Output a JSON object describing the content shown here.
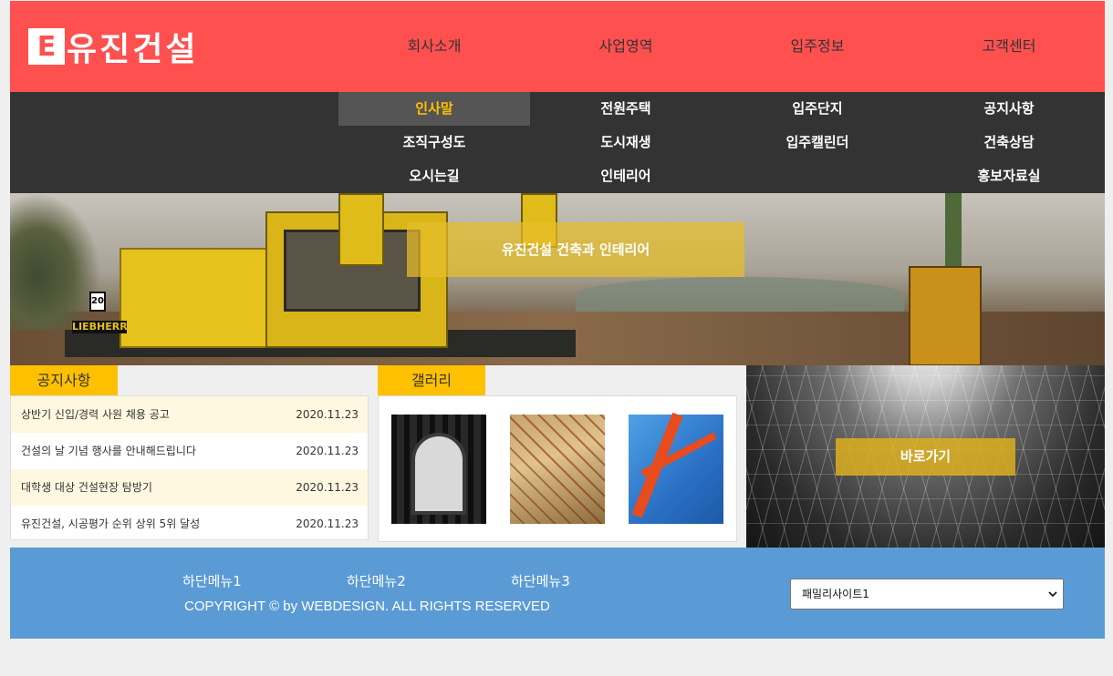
{
  "logo": {
    "mark": "E",
    "text": "유진건설"
  },
  "main_menu": [
    "회사소개",
    "사업영역",
    "입주정보",
    "고객센터"
  ],
  "sub_menu": [
    [
      "인사말",
      "조직구성도",
      "오시는길"
    ],
    [
      "전원주택",
      "도시재생",
      "인테리어"
    ],
    [
      "입주단지",
      "입주캘린더"
    ],
    [
      "공지사항",
      "건축상담",
      "홍보자료실"
    ]
  ],
  "visual": {
    "banner": "유진건설 건축과 인테리어",
    "machine_label": "LIEBHERR",
    "machine_sign": "20"
  },
  "notice": {
    "tab": "공지사항",
    "items": [
      {
        "title": "상반기 신입/경력 사원 채용 공고",
        "date": "2020.11.23"
      },
      {
        "title": "건설의 날 기념 행사를 안내해드립니다",
        "date": "2020.11.23"
      },
      {
        "title": "대학생 대상 건설현장 탐방기",
        "date": "2020.11.23"
      },
      {
        "title": "유진건설, 시공평가 순위 상위 5위 달성",
        "date": "2020.11.23"
      }
    ]
  },
  "gallery": {
    "tab": "갤러리"
  },
  "shortcut": {
    "label": "바로가기"
  },
  "footer": {
    "menu": [
      "하단메뉴1",
      "하단메뉴2",
      "하단메뉴3"
    ],
    "copyright": "COPYRIGHT © by WEBDESIGN. ALL RIGHTS RESERVED",
    "family_site": "패밀리사이트1"
  },
  "colors": {
    "header": "#ff5050",
    "submenu": "#333333",
    "accent": "#ffc000",
    "footer": "#5b9bd5"
  }
}
